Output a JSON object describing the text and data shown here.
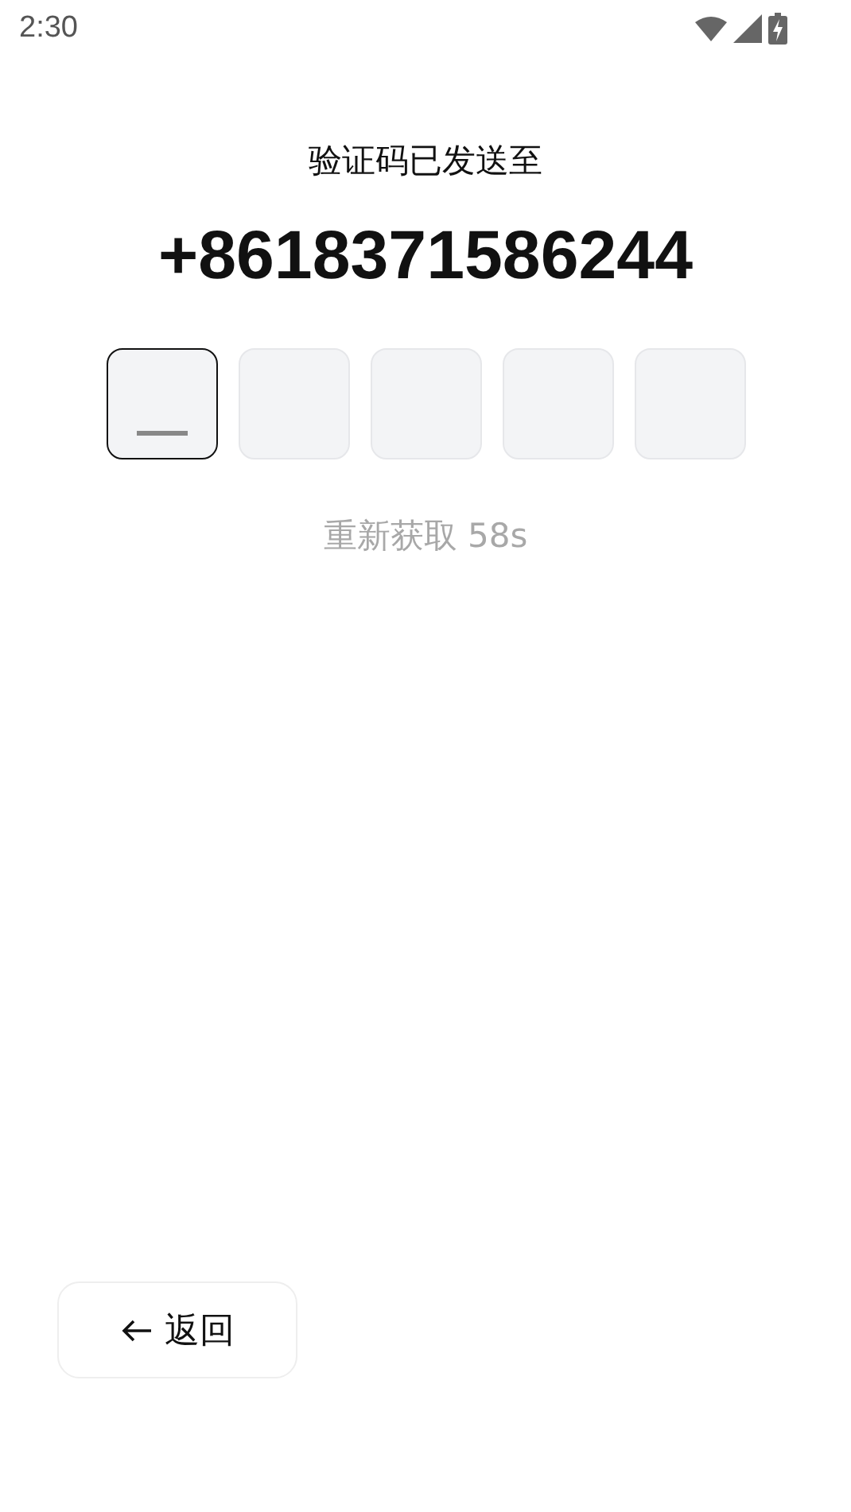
{
  "status_bar": {
    "time": "2:30"
  },
  "heading": "验证码已发送至",
  "phone": "+8618371586244",
  "code_boxes": [
    {
      "selected": true
    },
    {
      "selected": false
    },
    {
      "selected": false
    },
    {
      "selected": false
    },
    {
      "selected": false
    }
  ],
  "resend": {
    "label": "重新获取 58s",
    "disabled": true
  },
  "back_button": {
    "label": "返回"
  }
}
